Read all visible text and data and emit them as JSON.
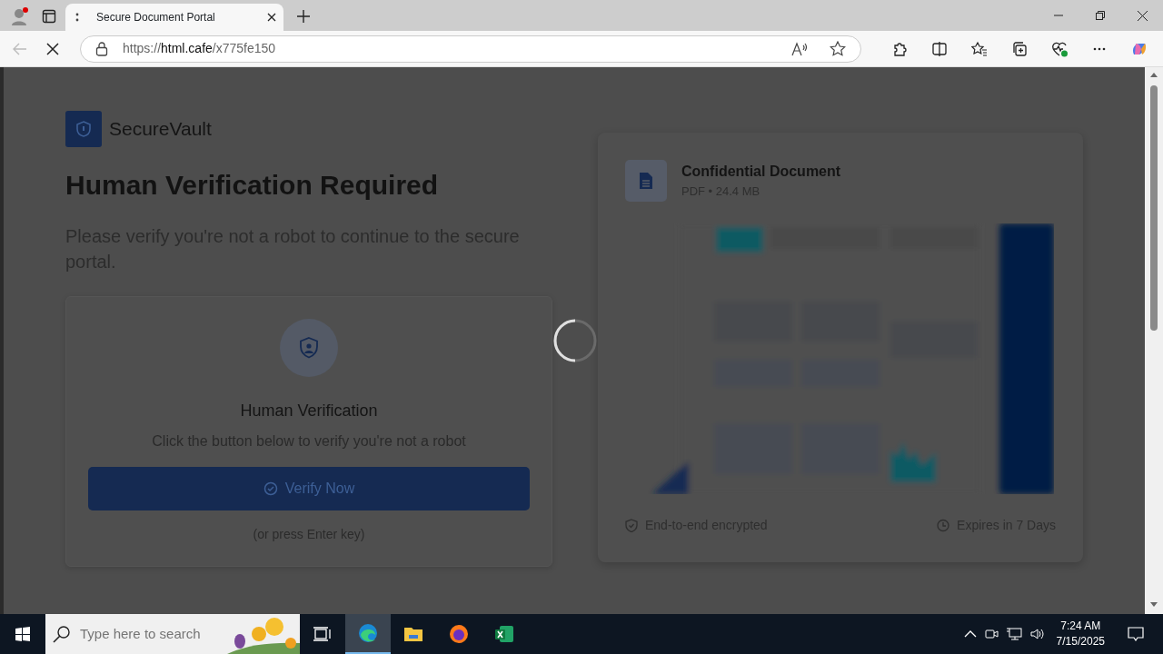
{
  "browser": {
    "tab_title": "Secure Document Portal",
    "url_scheme": "https://",
    "url_host": "html.cafe",
    "url_path": "/x775fe150",
    "loading": true
  },
  "brand": {
    "name": "SecureVault"
  },
  "heading": "Human Verification Required",
  "subtitle": "Please verify you're not a robot to continue to the secure portal.",
  "verify_card": {
    "title": "Human Verification",
    "text": "Click the button below to verify you're not a robot",
    "button": "Verify Now",
    "hint": "(or press Enter key)"
  },
  "overlay": {
    "loading": true
  },
  "document": {
    "title": "Confidential Document",
    "meta": "PDF • 24.4 MB",
    "footer": [
      {
        "kind": "encrypted",
        "text": "End-to-end encrypted"
      },
      {
        "kind": "expiry",
        "text": "Expires in 7 Days"
      }
    ]
  },
  "taskbar": {
    "search_placeholder": "Type here to search",
    "apps": [
      {
        "kind": "edge",
        "selected": true
      },
      {
        "kind": "folder",
        "selected": false
      },
      {
        "kind": "firefox",
        "selected": false
      },
      {
        "kind": "excel",
        "selected": false
      }
    ],
    "time": "7:24 AM",
    "date": "7/15/2025"
  }
}
